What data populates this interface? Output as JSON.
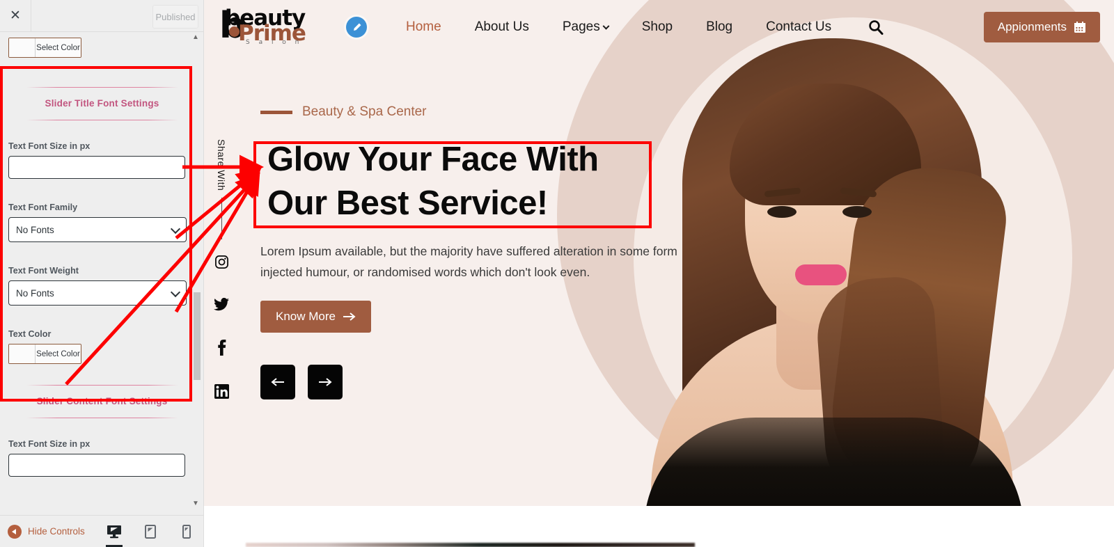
{
  "customizer": {
    "close_icon": "close-icon",
    "publish_button": "Published",
    "top_color_control": {
      "label": "Select Color",
      "swatch_hex": "#ffffff"
    },
    "sections": [
      {
        "title": "Slider Title Font Settings",
        "fields": [
          {
            "type": "text",
            "label": "Text Font Size in px",
            "value": "",
            "placeholder": ""
          },
          {
            "type": "select",
            "label": "Text Font Family",
            "value": "No Fonts"
          },
          {
            "type": "select",
            "label": "Text Font Weight",
            "value": "No Fonts"
          },
          {
            "type": "color",
            "label": "Text Color",
            "value": "Select Color"
          }
        ]
      },
      {
        "title": "Slider Content Font Settings",
        "fields": [
          {
            "type": "text",
            "label": "Text Font Size in px",
            "value": "",
            "placeholder": ""
          }
        ]
      }
    ],
    "footer": {
      "hide_controls_label": "Hide Controls",
      "devices": [
        {
          "name": "desktop",
          "active": true
        },
        {
          "name": "tablet",
          "active": false
        },
        {
          "name": "mobile",
          "active": false
        }
      ]
    },
    "accent_hex": "#b45f3e",
    "section_title_hex": "#c2557f",
    "highlight_hex": "#fd0000"
  },
  "preview": {
    "logo": {
      "word1": "beauty",
      "word2": "Prime",
      "word3": "S a l o n"
    },
    "edit_pencil_icon": "pencil-icon",
    "nav": [
      {
        "label": "Home",
        "active": true,
        "has_caret": false
      },
      {
        "label": "About Us",
        "active": false,
        "has_caret": false
      },
      {
        "label": "Pages",
        "active": false,
        "has_caret": true
      },
      {
        "label": "Shop",
        "active": false,
        "has_caret": false
      },
      {
        "label": "Blog",
        "active": false,
        "has_caret": false
      },
      {
        "label": "Contact Us",
        "active": false,
        "has_caret": false
      }
    ],
    "search_icon": "search-icon",
    "appointments_button": "Appionments",
    "appointments_icon": "calendar-icon",
    "social_rail": {
      "label": "Share With",
      "icons": [
        "instagram-icon",
        "twitter-icon",
        "facebook-icon",
        "linkedin-icon"
      ]
    },
    "hero": {
      "eyebrow": "Beauty & Spa Center",
      "title": "Glow Your Face With Our Best Service!",
      "description": "Lorem Ipsum available, but the majority have suffered alteration in some form injected humour, or randomised words which don't look even.",
      "cta_label": "Know More",
      "cta_icon": "arrow-right-icon",
      "prev_icon": "arrow-left-icon",
      "next_icon": "arrow-right-icon",
      "bg_hex": "#f7efec",
      "accent_hex": "#a05c40"
    }
  }
}
